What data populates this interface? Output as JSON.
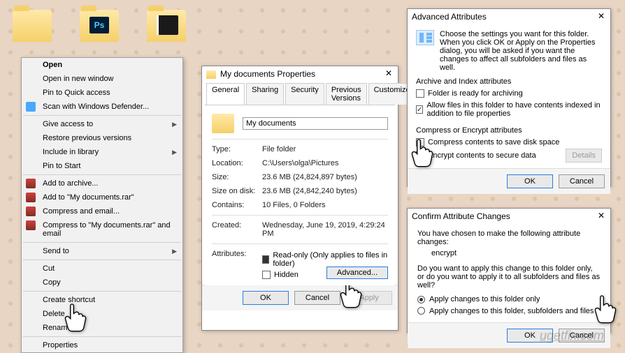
{
  "folders": [
    "",
    "",
    ""
  ],
  "context_menu": {
    "open": "Open",
    "open_new": "Open in new window",
    "pin_quick": "Pin to Quick access",
    "scan_defender": "Scan with Windows Defender...",
    "give_access": "Give access to",
    "restore_prev": "Restore previous versions",
    "include_lib": "Include in library",
    "pin_start": "Pin to Start",
    "add_archive": "Add to archive...",
    "add_rar": "Add to \"My documents.rar\"",
    "compress_email": "Compress and email...",
    "compress_rar_email": "Compress to \"My documents.rar\" and email",
    "send_to": "Send to",
    "cut": "Cut",
    "copy": "Copy",
    "create_shortcut": "Create shortcut",
    "delete": "Delete",
    "rename": "Rename",
    "properties": "Properties"
  },
  "properties": {
    "title": "My documents Properties",
    "tabs": {
      "general": "General",
      "sharing": "Sharing",
      "security": "Security",
      "prev": "Previous Versions",
      "customize": "Customize"
    },
    "name": "My documents",
    "labels": {
      "type": "Type:",
      "location": "Location:",
      "size": "Size:",
      "size_on_disk": "Size on disk:",
      "contains": "Contains:",
      "created": "Created:",
      "attributes": "Attributes:"
    },
    "type": "File folder",
    "location": "C:\\Users\\olga\\Pictures",
    "size": "23.6 MB (24,824,897 bytes)",
    "size_on_disk": "23.6 MB (24,842,240 bytes)",
    "contains": "10 Files, 0 Folders",
    "created": "Wednesday, June 19, 2019, 4:29:24 PM",
    "readonly": "Read-only (Only applies to files in folder)",
    "hidden": "Hidden",
    "advanced_btn": "Advanced...",
    "ok": "OK",
    "cancel": "Cancel",
    "apply": "Apply"
  },
  "advanced": {
    "title": "Advanced Attributes",
    "desc": "Choose the settings you want for this folder.\nWhen you click OK or Apply on the Properties dialog, you will be asked if you want the changes to affect all subfolders and files as well.",
    "archive_group": "Archive and Index attributes",
    "ready_archive": "Folder is ready for archiving",
    "allow_index": "Allow files in this folder to have contents indexed in addition to file properties",
    "compress_group": "Compress or Encrypt attributes",
    "compress": "Compress contents to save disk space",
    "encrypt": "Encrypt contents to secure data",
    "details": "Details",
    "ok": "OK",
    "cancel": "Cancel"
  },
  "confirm": {
    "title": "Confirm Attribute Changes",
    "intro": "You have chosen to make the following attribute changes:",
    "change": "encrypt",
    "question": "Do you want to apply this change to this folder only, or do you want to apply it to all subfolders and files as well?",
    "only": "Apply changes to this folder only",
    "all": "Apply changes to this folder, subfolders and files",
    "ok": "OK",
    "cancel": "Cancel"
  },
  "watermark": "ugetfix.com"
}
